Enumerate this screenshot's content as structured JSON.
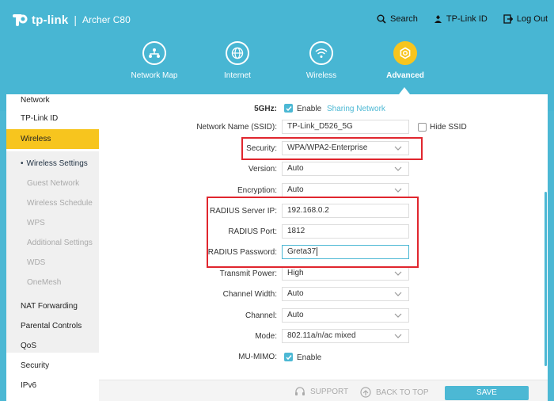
{
  "brand": {
    "name": "tp-link",
    "separator": "|",
    "model": "Archer C80"
  },
  "top_links": {
    "search": "Search",
    "tplink_id": "TP-Link ID",
    "logout": "Log Out"
  },
  "nav": [
    {
      "label": "Network Map",
      "icon": "network-map-icon"
    },
    {
      "label": "Internet",
      "icon": "globe-icon"
    },
    {
      "label": "Wireless",
      "icon": "wifi-icon"
    },
    {
      "label": "Advanced",
      "icon": "gear-icon",
      "active": true
    }
  ],
  "sidebar": {
    "items": [
      "Network",
      "TP-Link ID",
      "Wireless",
      "NAT Forwarding",
      "Parental Controls",
      "QoS",
      "Security",
      "IPv6"
    ],
    "sub_items": [
      "Wireless Settings",
      "Guest Network",
      "Wireless Schedule",
      "WPS",
      "Additional Settings",
      "WDS",
      "OneMesh"
    ]
  },
  "form": {
    "band": {
      "label": "5GHz:",
      "enable": "Enable",
      "sharing": "Sharing Network"
    },
    "ssid": {
      "label": "Network Name (SSID):",
      "value": "TP-Link_D526_5G",
      "hide": "Hide SSID"
    },
    "security": {
      "label": "Security:",
      "value": "WPA/WPA2-Enterprise"
    },
    "version": {
      "label": "Version:",
      "value": "Auto"
    },
    "encryption": {
      "label": "Encryption:",
      "value": "Auto"
    },
    "radius_ip": {
      "label": "RADIUS Server IP:",
      "value": "192.168.0.2"
    },
    "radius_port": {
      "label": "RADIUS Port:",
      "value": "1812"
    },
    "radius_password": {
      "label": "RADIUS Password:",
      "value": "Greta37"
    },
    "transmit_power": {
      "label": "Transmit Power:",
      "value": "High"
    },
    "channel_width": {
      "label": "Channel Width:",
      "value": "Auto"
    },
    "channel": {
      "label": "Channel:",
      "value": "Auto"
    },
    "mode": {
      "label": "Mode:",
      "value": "802.11a/n/ac mixed"
    },
    "mumimo": {
      "label": "MU-MIMO:",
      "enable": "Enable"
    }
  },
  "footer": {
    "support": "SUPPORT",
    "back_to_top": "BACK TO TOP",
    "save": "SAVE"
  },
  "colors": {
    "brand": "#48b6d3",
    "accent": "#f7c51e",
    "highlight": "#e0262e"
  }
}
